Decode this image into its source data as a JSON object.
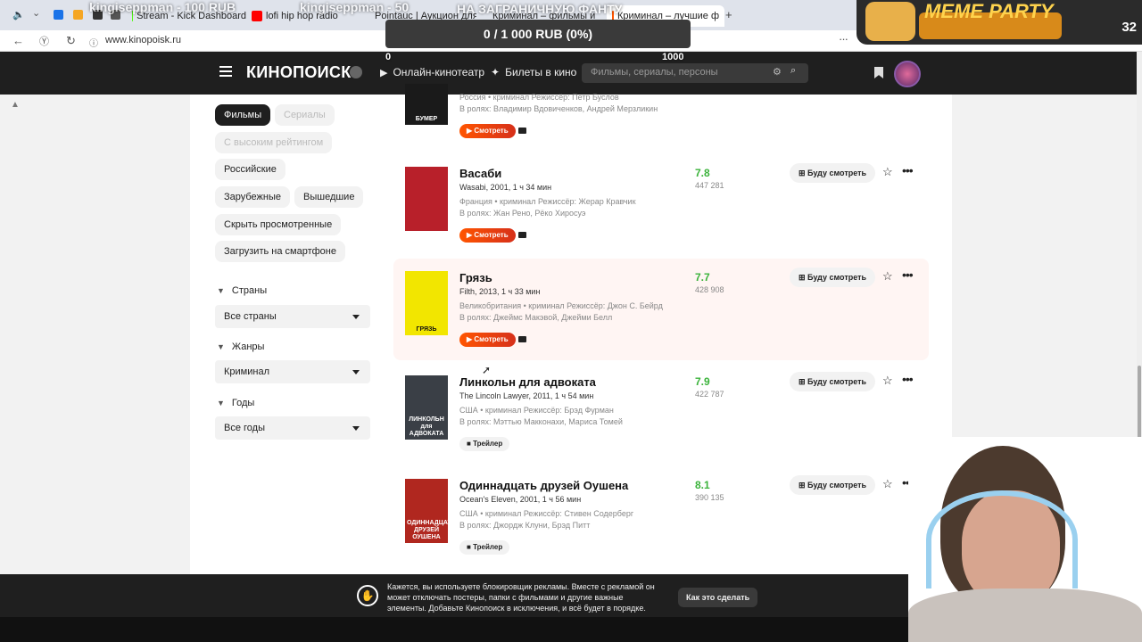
{
  "browser": {
    "tabs": [
      {
        "label": "kingiseppman - 100 RUB",
        "color": "#555"
      },
      {
        "label": "Stream - Kick Dashboard",
        "color": "#53fc18"
      },
      {
        "label": "lofi hip hop radio",
        "color": "#ff0000"
      },
      {
        "label": "Pointauc | Аукцион для с",
        "color": "#4aa0e0"
      },
      {
        "label": "Криминал – фильмы и с",
        "color": "#f50"
      },
      {
        "label": "Криминал – лучшие ф",
        "color": "#f50"
      }
    ],
    "new_tab": "+",
    "url": "www.kinopoisk.ru"
  },
  "overlay": {
    "donation_text": "0 / 1 000 RUB (0%)",
    "donation_min": "0",
    "donation_max": "1000",
    "ghost_1": "kingiseppman - 50",
    "ghost_2": "НА ЗАГРАНИЧНУЮ ФАНТУ",
    "meme_title": "MEME PARTY",
    "meme_count": "32"
  },
  "header": {
    "logo": "КИНОПОИСК",
    "nav_online": "Онлайн-кинотеатр",
    "nav_tickets": "Билеты в кино",
    "search_placeholder": "Фильмы, сериалы, персоны"
  },
  "filters": {
    "films": "Фильмы",
    "series": "Сериалы",
    "high_rating": "С высоким рейтингом",
    "russian": "Российские",
    "foreign": "Зарубежные",
    "released": "Вышедшие",
    "hide_watched": "Скрыть просмотренные",
    "download": "Загрузить на смартфоне",
    "countries_label": "Страны",
    "countries_value": "Все страны",
    "genres_label": "Жанры",
    "genres_value": "Криминал",
    "years_label": "Годы",
    "years_value": "Все годы"
  },
  "movies": [
    {
      "title": "",
      "original": "",
      "info": "Россия • криминал  Режиссёр: Петр Буслов",
      "cast": "В ролях: Владимир Вдовиченков, Андрей Мерзликин",
      "button": "Смотреть",
      "rating": "",
      "votes": "",
      "poster_text": "БУМЕР",
      "poster_color": "#1a1a1a",
      "rating_color": "#3bb33b"
    },
    {
      "title": "Васаби",
      "original": "Wasabi, 2001, 1 ч 34 мин",
      "info": "Франция • криминал  Режиссёр: Жерар Кравчик",
      "cast": "В ролях: Жан Рено, Рёко Хиросуэ",
      "button": "Смотреть",
      "rating": "7.8",
      "votes": "447 281",
      "poster_text": "",
      "poster_color": "#b8202a",
      "rating_color": "#3bb33b"
    },
    {
      "title": "Грязь",
      "original": "Filth, 2013, 1 ч 33 мин",
      "info": "Великобритания • криминал  Режиссёр: Джон С. Бейрд",
      "cast": "В ролях: Джеймс Макэвой, Джейми Белл",
      "button": "Смотреть",
      "rating": "7.7",
      "votes": "428 908",
      "poster_text": "ГРЯЗЬ",
      "poster_color": "#f2e600",
      "rating_color": "#3bb33b"
    },
    {
      "title": "Линкольн для адвоката",
      "original": "The Lincoln Lawyer, 2011, 1 ч 54 мин",
      "info": "США • криминал  Режиссёр: Брэд Фурман",
      "cast": "В ролях: Мэттью Макконахи, Мариса Томей",
      "button": "Трейлер",
      "rating": "7.9",
      "votes": "422 787",
      "poster_text": "ЛИНКОЛЬН для АДВОКАТА",
      "poster_color": "#3a3f46",
      "rating_color": "#3bb33b"
    },
    {
      "title": "Одиннадцать друзей Оушена",
      "original": "Ocean's Eleven, 2001, 1 ч 56 мин",
      "info": "США • криминал  Режиссёр: Стивен Содерберг",
      "cast": "В ролях: Джордж Клуни, Брэд Питт",
      "button": "Трейлер",
      "rating": "8.1",
      "votes": "390 135",
      "poster_text": "ОДИННАДЦАТЬ ДРУЗЕЙ ОУШЕНА",
      "poster_color": "#b0271f",
      "rating_color": "#3bb33b"
    }
  ],
  "movie_actions": {
    "watchlist": "Буду смотреть",
    "star_icon": "star-icon",
    "more_icon": "more-icon"
  },
  "ad_banner": {
    "text": "Кажется, вы используете блокировщик рекламы. Вместе с рекламой он может отключать постеры, папки с фильмами и другие важные элементы. Добавьте Кинопоиск в исключения, и всё будет в порядке.",
    "button": "Как это сделать",
    "close": "✕"
  }
}
